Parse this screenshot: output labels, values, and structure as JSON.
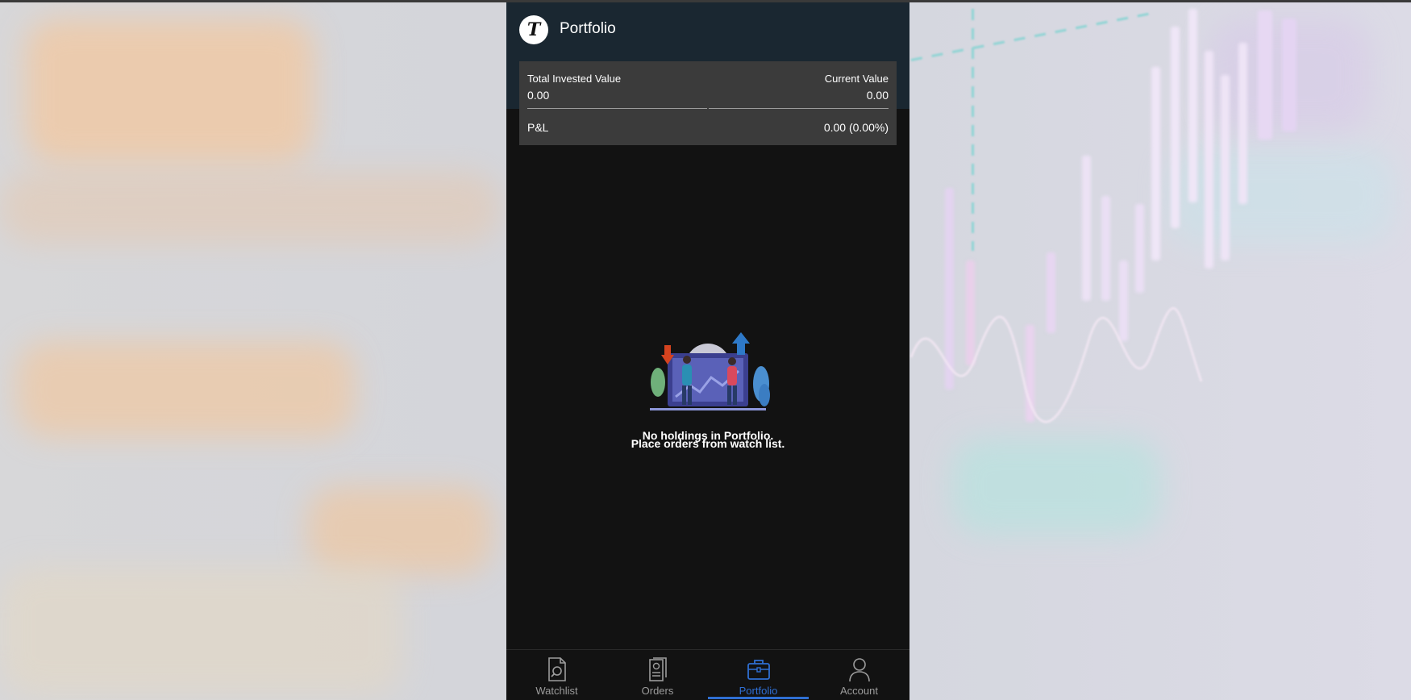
{
  "app": {
    "logo_letter": "T",
    "title": "Portfolio",
    "accent_color": "#2f6fd3",
    "header_color": "#1a2731"
  },
  "summary": {
    "invested_label": "Total Invested Value",
    "invested_value": "0.00",
    "current_label": "Current Value",
    "current_value": "0.00",
    "pnl_label": "P&L",
    "pnl_value": "0.00 (0.00%)"
  },
  "empty_state": {
    "illustration_icon": "buy-sell-illustration",
    "line1": "No holdings in Portfolio.",
    "line2": "Place orders from watch list."
  },
  "nav": {
    "items": [
      {
        "label": "Watchlist",
        "icon": "watchlist-icon",
        "active": false
      },
      {
        "label": "Orders",
        "icon": "orders-icon",
        "active": false
      },
      {
        "label": "Portfolio",
        "icon": "briefcase-icon",
        "active": true
      },
      {
        "label": "Account",
        "icon": "user-icon",
        "active": false
      }
    ]
  }
}
